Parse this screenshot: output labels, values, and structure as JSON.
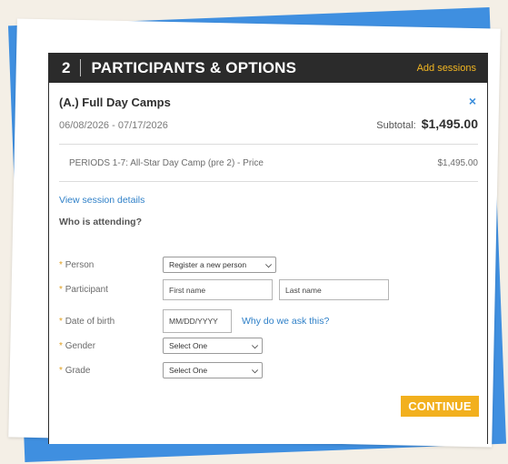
{
  "header": {
    "step_number": "2",
    "title": "PARTICIPANTS & OPTIONS",
    "add_sessions": "Add sessions"
  },
  "camp": {
    "title": "(A.) Full Day Camps",
    "dates": "06/08/2026 - 07/17/2026",
    "subtotal_label": "Subtotal:",
    "subtotal": "$1,495.00",
    "close": "×"
  },
  "line_item": {
    "description": "PERIODS 1-7: All-Star Day Camp (pre 2) - Price",
    "price": "$1,495.00"
  },
  "view_details": "View session details",
  "who_attending": "Who is attending?",
  "form": {
    "required_marker": "*",
    "person_label": "Person",
    "person_value": "Register a new person",
    "participant_label": "Participant",
    "first_name_placeholder": "First name",
    "last_name_placeholder": "Last name",
    "dob_label": "Date of birth",
    "dob_placeholder": "MM/DD/YYYY",
    "why_link": "Why do we ask this?",
    "gender_label": "Gender",
    "gender_value": "Select One",
    "grade_label": "Grade",
    "grade_value": "Select One"
  },
  "continue_label": "CONTINUE",
  "icons": {
    "chevron": "chevron-down-icon",
    "close": "close-icon"
  },
  "colors": {
    "accent_blue": "#3f8fe0",
    "link_blue": "#2f80c8",
    "button_gold": "#f2b01e",
    "header_dark": "#2b2b2b"
  }
}
